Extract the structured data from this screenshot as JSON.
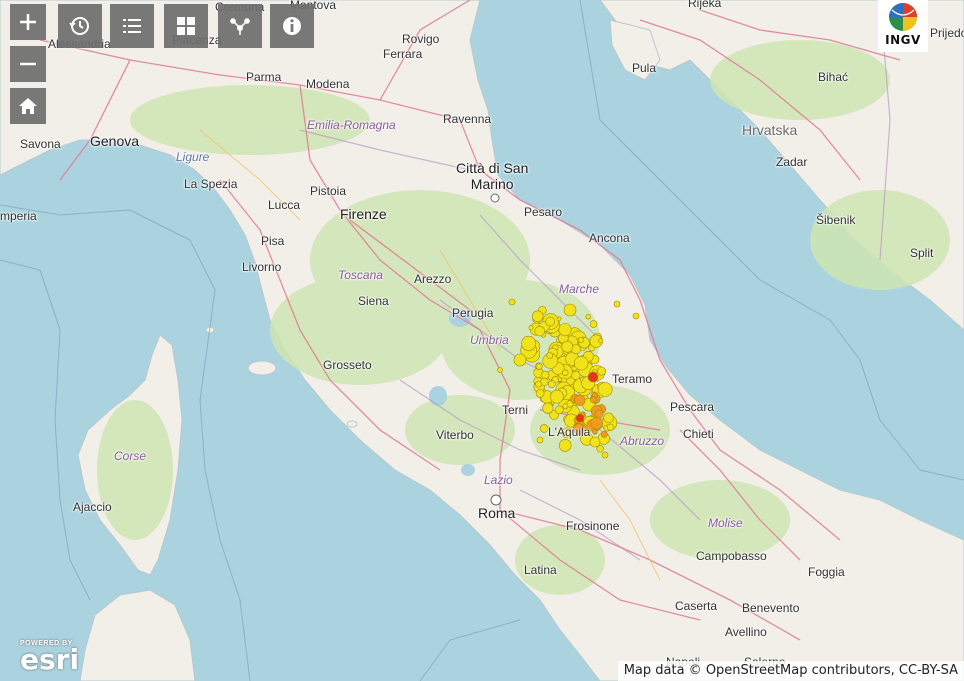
{
  "toolbar": {
    "zoom_in_icon": "plus-icon",
    "zoom_out_icon": "minus-icon",
    "home_icon": "home-icon",
    "buttons": [
      "history-icon",
      "list-icon",
      "grid-icon",
      "share-icon",
      "info-icon"
    ]
  },
  "logo": {
    "text": "INGV"
  },
  "branding": {
    "powered_by": "POWERED BY",
    "esri": "esri"
  },
  "attribution": "Map data © OpenStreetMap contributors, CC-BY-SA",
  "colors": {
    "sea": "#aad3df",
    "land": "#f2efe9",
    "vegetation": "#cfe5b3",
    "roads": "#e07a94",
    "quake_yellow": "#f1e31b",
    "quake_orange": "#f29a1f",
    "quake_red": "#e8361d",
    "toolbar": "#6e6e6e"
  },
  "labels": {
    "cremona": "Cremona",
    "mantova": "Mantova",
    "alessandria": "Alessandria",
    "piacenza": "Piacenza",
    "rovigo": "Rovigo",
    "ferrara": "Ferrara",
    "parma": "Parma",
    "modena": "Modena",
    "emilia_romagna": "Emilia-Romagna",
    "ravenna": "Ravenna",
    "genova": "Genova",
    "savona": "Savona",
    "ligurian_sea": "Ligure",
    "la_spezia": "La Spezia",
    "pistoia": "Pistoia",
    "lucca": "Lucca",
    "firenze": "Firenze",
    "pisa": "Pisa",
    "imperia": "mperia",
    "livorno": "Livorno",
    "toscana": "Toscana",
    "arezzo": "Arezzo",
    "siena": "Siena",
    "san_marino": "Città di San\nMarino",
    "pesaro": "Pesaro",
    "ancona": "Ancona",
    "marche": "Marche",
    "perugia": "Perugia",
    "umbria": "Umbria",
    "grosseto": "Grosseto",
    "teramo": "Teramo",
    "pescara": "Pescara",
    "chieti": "Chieti",
    "terni": "Terni",
    "laquila": "L'Aquila",
    "abruzzo": "Abruzzo",
    "viterbo": "Viterbo",
    "lazio": "Lazio",
    "roma": "Roma",
    "frosinone": "Frosinone",
    "molise": "Molise",
    "campobasso": "Campobasso",
    "foggia": "Foggia",
    "latina": "Latina",
    "caserta": "Caserta",
    "benevento": "Benevento",
    "avellino": "Avellino",
    "napoli": "Napoli",
    "salerno": "Salerno",
    "corse": "Corse",
    "ajaccio": "Ajaccio",
    "rijeka": "Rijeka",
    "pula": "Pula",
    "bihac": "Bihać",
    "hrvatska": "Hrvatska",
    "zadar": "Zadar",
    "sibenik": "Šibenik",
    "split": "Split",
    "prijedor": "Prijedo"
  }
}
